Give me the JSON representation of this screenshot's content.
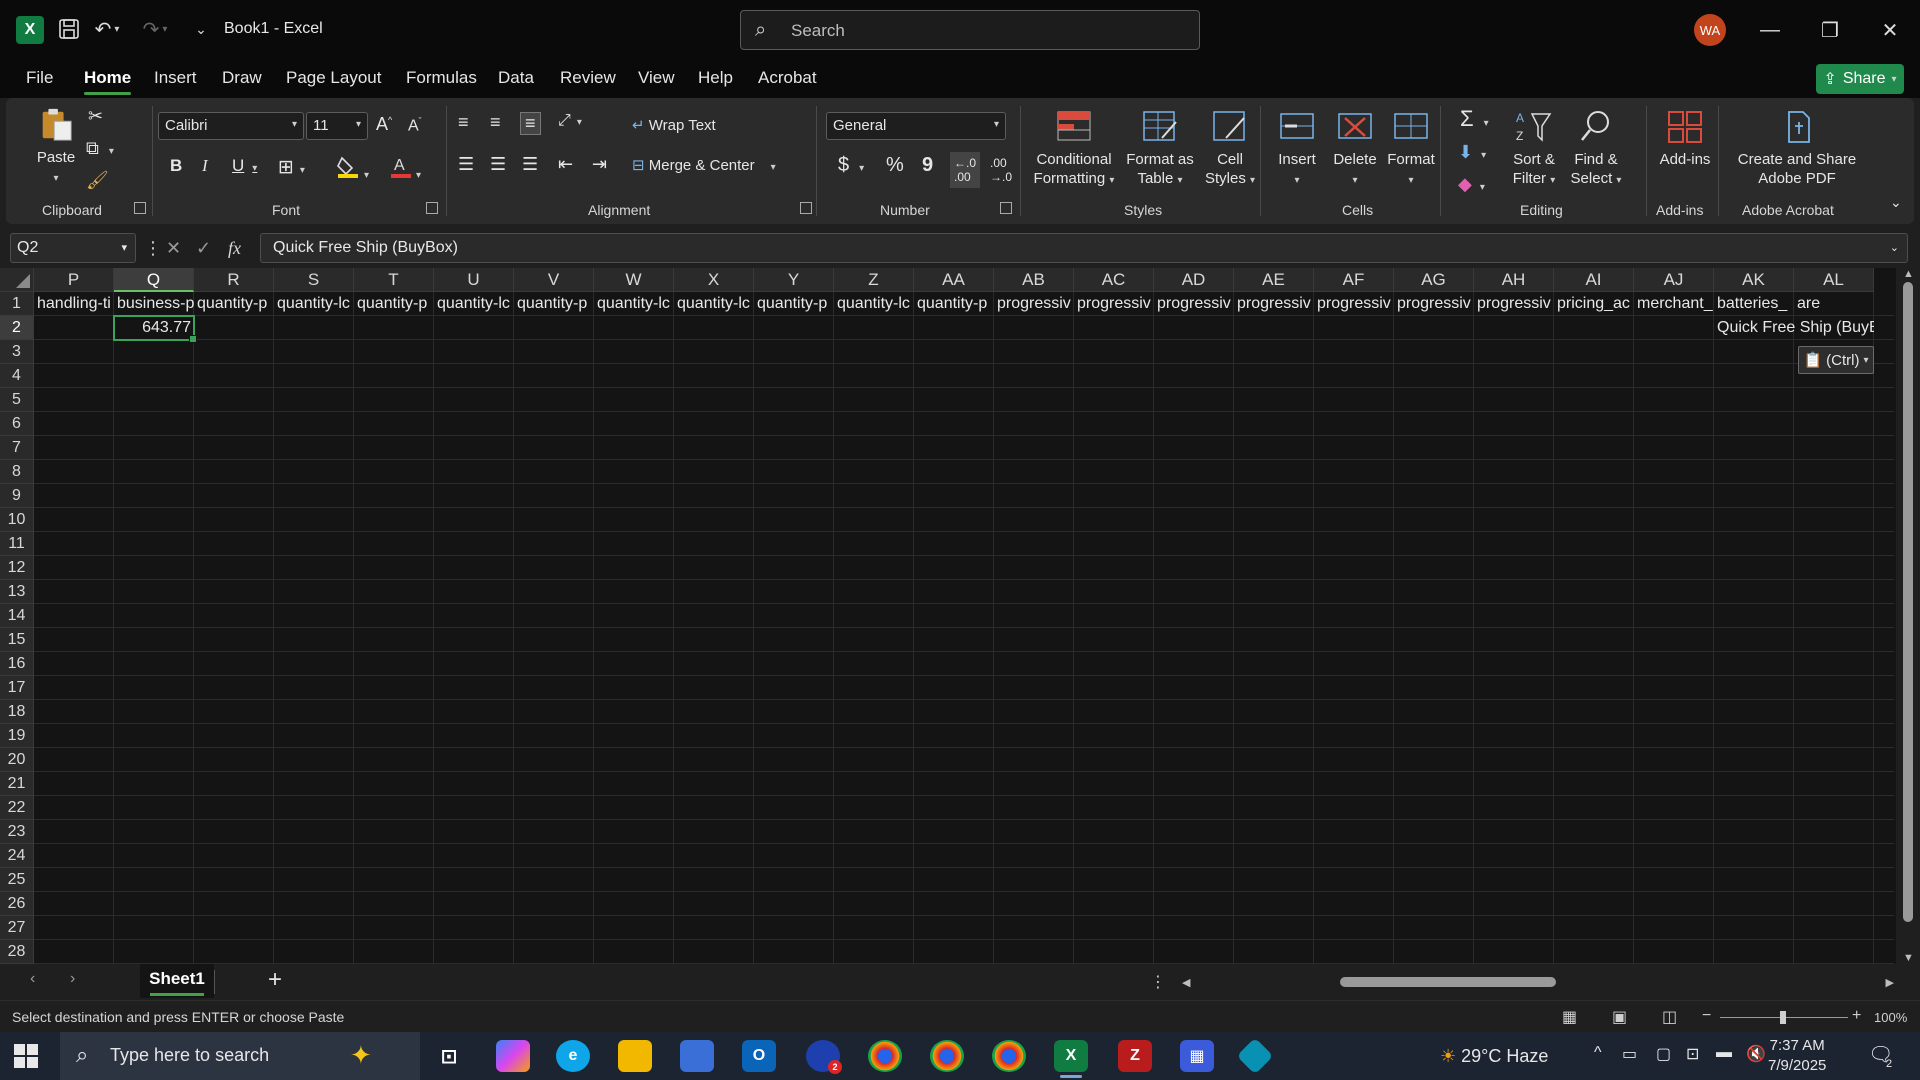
{
  "app": {
    "title": "Book1  -  Excel",
    "search_placeholder": "Search",
    "avatar_initials": "WA",
    "share_label": "Share"
  },
  "menu": [
    "File",
    "Home",
    "Insert",
    "Draw",
    "Page Layout",
    "Formulas",
    "Data",
    "Review",
    "View",
    "Help",
    "Acrobat"
  ],
  "ribbon": {
    "clipboard": {
      "paste": "Paste",
      "group": "Clipboard"
    },
    "font": {
      "name": "Calibri",
      "size": "11",
      "bold": "B",
      "italic": "I",
      "underline": "U",
      "group": "Font"
    },
    "alignment": {
      "wrap": "Wrap Text",
      "merge": "Merge & Center",
      "group": "Alignment"
    },
    "number": {
      "format": "General",
      "currency": "$",
      "percent": "%",
      "comma": "9",
      "group": "Number"
    },
    "styles": {
      "conditional": [
        "Conditional",
        "Formatting"
      ],
      "table": [
        "Format as",
        "Table"
      ],
      "cell": [
        "Cell",
        "Styles"
      ],
      "group": "Styles"
    },
    "cells": {
      "insert": "Insert",
      "delete": "Delete",
      "format": "Format",
      "group": "Cells"
    },
    "editing": {
      "sort": [
        "Sort &",
        "Filter"
      ],
      "find": [
        "Find &",
        "Select"
      ],
      "group": "Editing"
    },
    "addins": {
      "label": "Add-ins",
      "group": "Add-ins"
    },
    "acrobat": {
      "label": [
        "Create and Share",
        "Adobe PDF"
      ],
      "group": "Adobe Acrobat"
    }
  },
  "formula_bar": {
    "name_box": "Q2",
    "fx": "fx",
    "content": "Quick Free Ship (BuyBox)"
  },
  "columns": [
    "P",
    "Q",
    "R",
    "S",
    "T",
    "U",
    "V",
    "W",
    "X",
    "Y",
    "Z",
    "AA",
    "AB",
    "AC",
    "AD",
    "AE",
    "AF",
    "AG",
    "AH",
    "AI",
    "AJ",
    "AK",
    "AL"
  ],
  "selected_column": "Q",
  "selected_row": 2,
  "rows": [
    1,
    2,
    3,
    4,
    5,
    6,
    7,
    8,
    9,
    10,
    11,
    12,
    13,
    14,
    15,
    16,
    17,
    18,
    19,
    20,
    21,
    22,
    23,
    24,
    25,
    26,
    27,
    28
  ],
  "row1": [
    "handling-ti",
    "business-p",
    "quantity-p",
    "quantity-lc",
    "quantity-p",
    "quantity-lc",
    "quantity-p",
    "quantity-lc",
    "quantity-lc",
    "quantity-p",
    "quantity-lc",
    "quantity-p",
    "progressiv",
    "progressiv",
    "progressiv",
    "progressiv",
    "progressiv",
    "progressiv",
    "progressiv",
    "pricing_ac",
    "merchant_",
    "batteries_",
    "are"
  ],
  "row2": {
    "Q": "643.77",
    "AK": "Quick Free Ship (BuyBox"
  },
  "paste_options": "(Ctrl)",
  "sheet": {
    "tab": "Sheet1",
    "add": "+"
  },
  "status": {
    "message": "Select destination and press ENTER or choose Paste",
    "zoom": "100%"
  },
  "taskbar": {
    "search_placeholder": "Type here to search",
    "weather": "29°C  Haze",
    "time": "7:37 AM",
    "date": "7/9/2025",
    "notification_count": "2",
    "weather_badge": "2"
  }
}
